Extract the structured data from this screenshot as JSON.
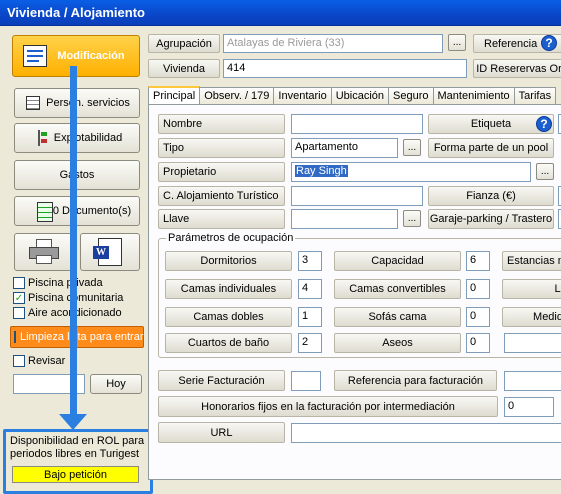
{
  "window": {
    "title": "Vivienda / Alojamiento"
  },
  "left": {
    "modificacion": "Modificación",
    "person_servicios": "Person. servicios",
    "explotabilidad": "Explotabilidad",
    "gastos": "Gastos",
    "documentos": "0 Documento(s)",
    "checks": [
      {
        "label": "Piscina privada",
        "checked": ""
      },
      {
        "label": "Piscina comunitaria",
        "checked": "✓"
      },
      {
        "label": "Aire acondicionado",
        "checked": ""
      }
    ],
    "limpieza": "Limpieza lista para entrar",
    "revisar": "Revisar",
    "hoy": "Hoy",
    "disponibilidad": "Disponibilidad en ROL para periodos libres en Turigest",
    "bajo_peticion": "Bajo petición"
  },
  "header": {
    "agrupacion_label": "Agrupación",
    "agrupacion_value": "Atalayas de Riviera (33)",
    "referencia_label": "Referencia",
    "vivienda_label": "Vivienda",
    "vivienda_value": "414",
    "id_reservas_label": "ID Reserervas Or"
  },
  "tabs": [
    "Principal",
    "Observ. / 179",
    "Inventario",
    "Ubicación",
    "Seguro",
    "Mantenimiento",
    "Tarifas"
  ],
  "principal": {
    "nombre": "Nombre",
    "etiqueta": "Etiqueta",
    "tipo": "Tipo",
    "tipo_value": "Apartamento",
    "forma_parte": "Forma parte de un pool",
    "propietario": "Propietario",
    "propietario_value": "Ray Singh",
    "c_alojamiento": "C. Alojamiento Turístico",
    "fianza": "Fianza (€)",
    "llave": "Llave",
    "garaje": "Garaje-parking / Trastero",
    "parametros": "Parámetros de ocupación",
    "dormitorios": "Dormitorios",
    "dormitorios_v": "3",
    "capacidad": "Capacidad",
    "capacidad_v": "6",
    "estancias": "Estancias m",
    "camas_ind": "Camas individuales",
    "camas_ind_v": "4",
    "camas_conv": "Camas convertibles",
    "camas_conv_v": "0",
    "li": "Li",
    "camas_dobles": "Camas dobles",
    "camas_dobles_v": "1",
    "sofas": "Sofás cama",
    "sofas_v": "0",
    "medid": "Medid",
    "cuartos": "Cuartos de baño",
    "cuartos_v": "2",
    "aseos": "Aseos",
    "aseos_v": "0",
    "serie": "Serie Facturación",
    "ref_fact": "Referencia para facturación",
    "honorarios": "Honorarios fijos en la facturación por intermediación",
    "honorarios_v": "0",
    "url": "URL"
  },
  "colors": {
    "accent": "#2b7fe0",
    "highlight_button": "#ffc000",
    "limpieza": "#ff8c1a",
    "badge": "#ffff00"
  },
  "icons": [
    "document-edit-icon",
    "calendar-icon",
    "tree-icon",
    "spreadsheet-icon",
    "printer-icon",
    "word-icon",
    "help-icon"
  ]
}
